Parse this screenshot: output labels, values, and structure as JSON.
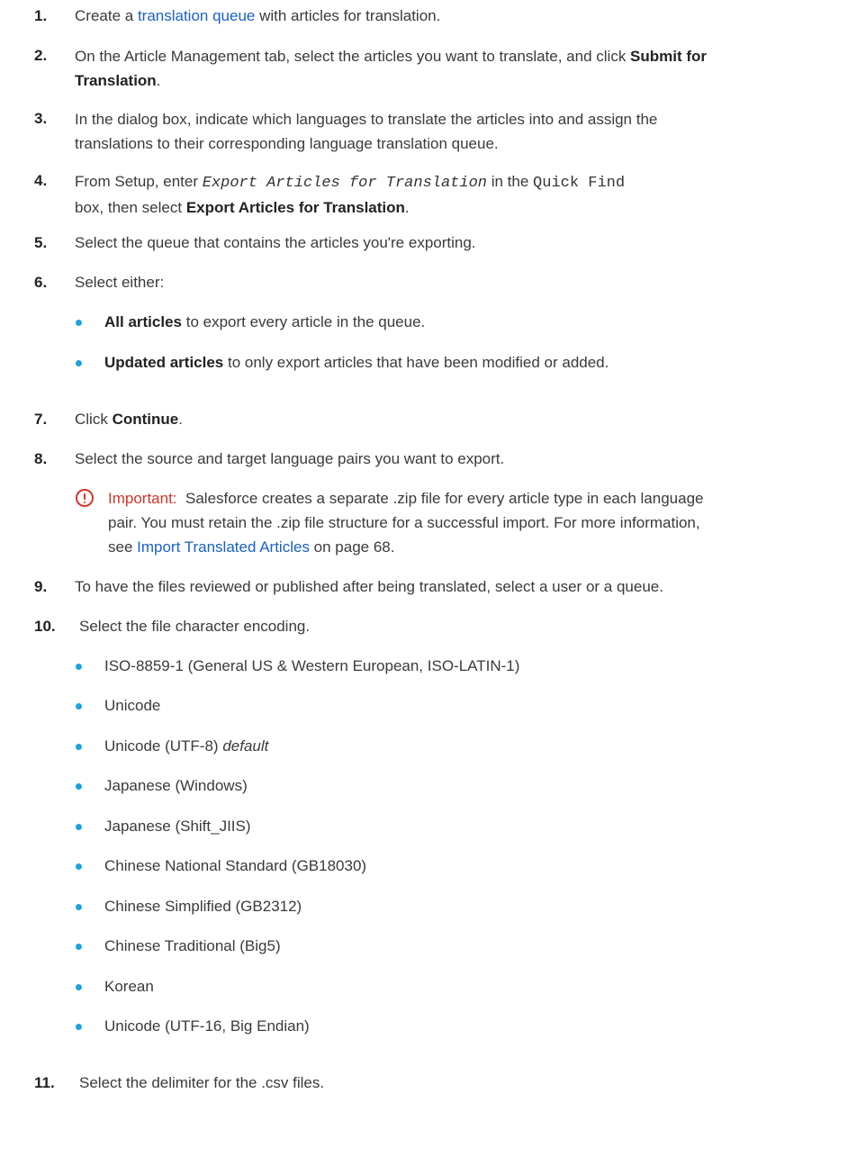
{
  "steps": [
    {
      "num": "1.",
      "pre": "Create a ",
      "link": "translation queue",
      "post": " with articles for translation."
    },
    {
      "num": "2.",
      "text": "On the Article Management tab, select the articles you want to translate, and click ",
      "bold1": "Submit for",
      "bold2": "Translation",
      "post": "."
    },
    {
      "num": "3.",
      "line1": "In the dialog box, indicate which languages to translate the articles into and assign the",
      "line2": "translations to their corresponding language translation queue."
    },
    {
      "num": "4.",
      "pre": "From Setup, enter ",
      "code1": "Export Articles for Translation",
      "mid": " in the ",
      "code2": "Quick Find",
      "line2_pre": "box, then select ",
      "bold": "Export Articles for Translation",
      "post": "."
    },
    {
      "num": "5.",
      "text": "Select the queue that contains the articles you're exporting."
    },
    {
      "num": "6.",
      "text": "Select either:"
    },
    {
      "num": "7.",
      "pre": "Click ",
      "bold": "Continue",
      "post": "."
    },
    {
      "num": "8.",
      "text": "Select the source and target language pairs you want to export."
    },
    {
      "num": "9.",
      "text": "To have the files reviewed or published after being translated, select a user or a queue."
    },
    {
      "num": "10.",
      "text": "Select the file character encoding."
    },
    {
      "num": "11.",
      "text": "Select the delimiter for the .csv files."
    }
  ],
  "export_options": [
    {
      "bold": "All articles",
      "text": " to export every article in the queue."
    },
    {
      "bold": "Updated articles",
      "text": " to only export articles that have been modified or added."
    }
  ],
  "note": {
    "icon": "important-icon",
    "label": "Important:",
    "line1": "Salesforce creates a separate .zip file for every article type in each language",
    "line2": "pair. You must retain the .zip file structure for a successful import. For more information,",
    "line3_pre": "see ",
    "link": "Import Translated Articles",
    "line3_post": " on page 68.",
    "colors": {
      "accent": "#d0362a",
      "link": "#1a61c4"
    }
  },
  "encodings": [
    {
      "text": "ISO-8859-1 (General US & Western European, ISO-LATIN-1)"
    },
    {
      "text": "Unicode"
    },
    {
      "text": "Unicode (UTF-8) ",
      "italic": "default"
    },
    {
      "text": "Japanese (Windows)"
    },
    {
      "text": "Japanese (Shift_JIIS)"
    },
    {
      "text": "Chinese National Standard (GB18030)"
    },
    {
      "text": "Chinese Simplified (GB2312)"
    },
    {
      "text": "Chinese Traditional (Big5)"
    },
    {
      "text": "Korean"
    },
    {
      "text": "Unicode (UTF-16, Big Endian)"
    }
  ]
}
